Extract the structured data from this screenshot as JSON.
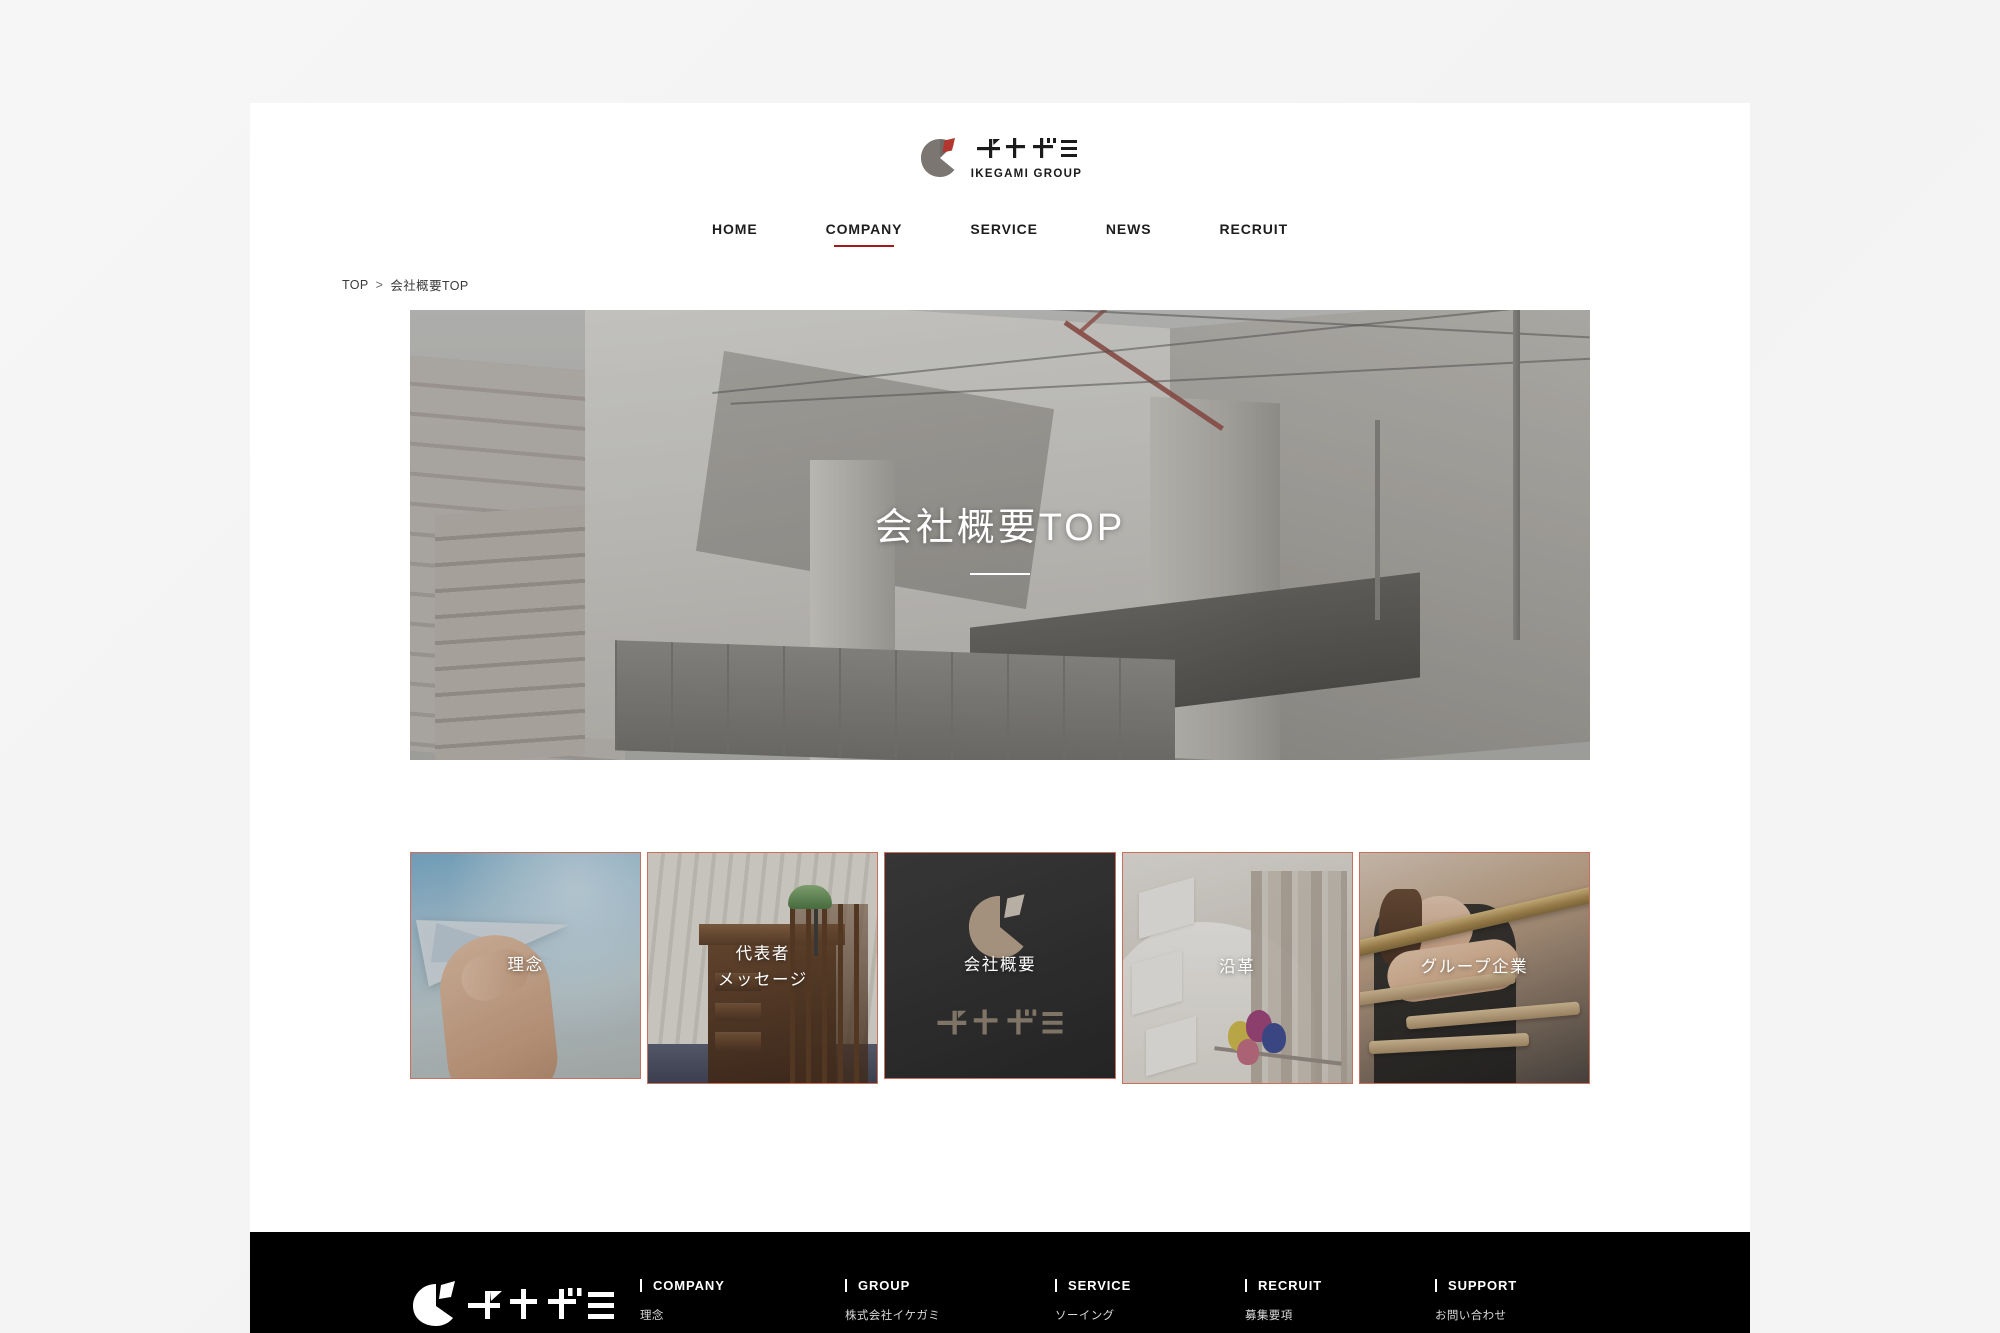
{
  "brand": {
    "logo_mark": "ikegami-logo-mark",
    "logo_kana": "イケガミ",
    "logo_en": "IKEGAMI GROUP",
    "accent_red": "#a11b1b",
    "card_border": "#c8705f"
  },
  "nav": {
    "items": [
      {
        "label": "HOME",
        "active": false
      },
      {
        "label": "COMPANY",
        "active": true
      },
      {
        "label": "SERVICE",
        "active": false
      },
      {
        "label": "NEWS",
        "active": false
      },
      {
        "label": "RECRUIT",
        "active": false
      }
    ]
  },
  "breadcrumb": {
    "home": "TOP",
    "separator": ">",
    "current": "会社概要TOP"
  },
  "hero": {
    "title": "会社概要TOP",
    "image_alt": "ikegami-headquarters-building-photo"
  },
  "cards": [
    {
      "label": "理念",
      "image_alt": "paper-plane-sky-photo"
    },
    {
      "label_line1": "代表者",
      "label_line2": "メッセージ",
      "image_alt": "desk-with-lamp-photo"
    },
    {
      "label": "会社概要",
      "image_alt": "logo-wall-photo"
    },
    {
      "label": "沿革",
      "image_alt": "atrium-interior-photo"
    },
    {
      "label": "グループ企業",
      "image_alt": "clothing-hangers-photo"
    }
  ],
  "footer": {
    "logo_kana": "イケガミ",
    "columns": [
      {
        "heading": "COMPANY",
        "links": [
          "理念"
        ]
      },
      {
        "heading": "GROUP",
        "links": [
          "株式会社イケガミ"
        ]
      },
      {
        "heading": "SERVICE",
        "links": [
          "ソーイング"
        ]
      },
      {
        "heading": "RECRUIT",
        "links": [
          "募集要項"
        ]
      },
      {
        "heading": "SUPPORT",
        "links": [
          "お問い合わせ"
        ]
      }
    ]
  }
}
